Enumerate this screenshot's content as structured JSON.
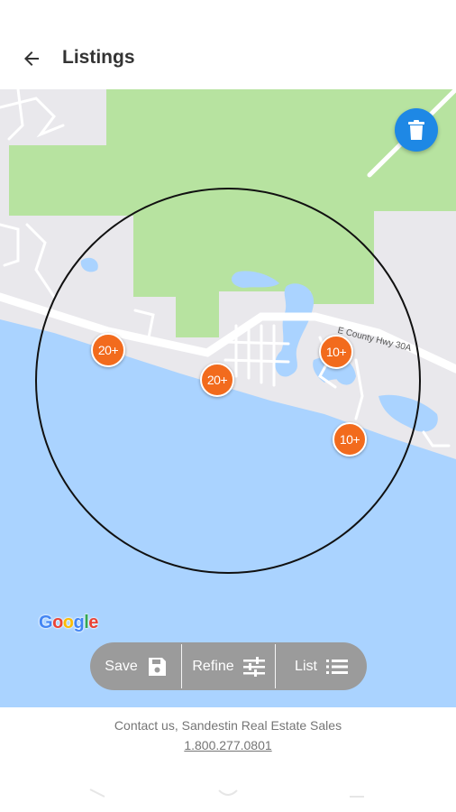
{
  "header": {
    "title": "Listings",
    "back_icon": "arrow-left-icon"
  },
  "map": {
    "road_label": "E County Hwy 30A",
    "google_logo": "Google",
    "google_colors": [
      "#4285F4",
      "#EA4335",
      "#FBBC05",
      "#4285F4",
      "#34A853",
      "#EA4335"
    ],
    "trash_icon": "trash-icon",
    "trash_color": "#1e88e5",
    "cluster_color": "#f26b1d",
    "water_color": "#aad3ff",
    "park_color": "#b7e3a0",
    "clusters": [
      {
        "label": "20+"
      },
      {
        "label": "20+"
      },
      {
        "label": "10+"
      },
      {
        "label": "10+"
      }
    ]
  },
  "toolbar": {
    "background": "#9b9b9b",
    "save_label": "Save",
    "save_icon": "floppy-disk-icon",
    "refine_label": "Refine",
    "refine_icon": "sliders-icon",
    "list_label": "List",
    "list_icon": "list-icon"
  },
  "footer": {
    "contact_text": "Contact us, Sandestin Real Estate Sales",
    "phone": "1.800.277.0801"
  }
}
